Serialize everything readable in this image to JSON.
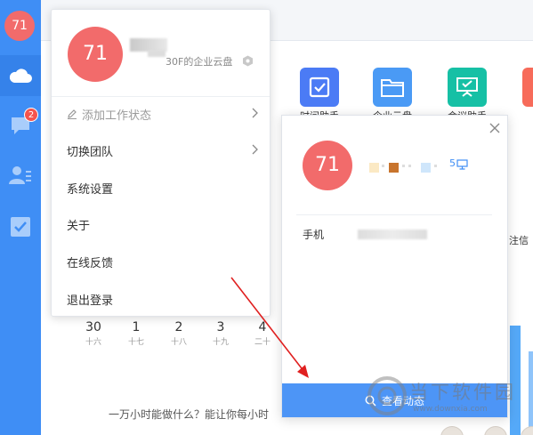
{
  "rail": {
    "avatar_text": "71",
    "badge_count": "2",
    "nav_items": [
      {
        "name": "cloud-icon",
        "active": true
      },
      {
        "name": "chat-icon",
        "active": false
      },
      {
        "name": "contacts-icon",
        "active": false
      },
      {
        "name": "checkbox-icon",
        "active": false
      }
    ]
  },
  "apps": [
    {
      "label": "时间助手",
      "icon": "checkbox-icon",
      "color": "#4b7bf5"
    },
    {
      "label": "企业云盘",
      "icon": "folder-icon",
      "color": "#4a9af5"
    },
    {
      "label": "会议助手",
      "icon": "presentation-icon",
      "color": "#16c0a5"
    },
    {
      "label": "",
      "icon": "app-icon",
      "color": "#f76b5a"
    }
  ],
  "side_text": "注信",
  "calendar": [
    {
      "day": "30",
      "sub": "十六"
    },
    {
      "day": "1",
      "sub": "十七"
    },
    {
      "day": "2",
      "sub": "十八"
    },
    {
      "day": "3",
      "sub": "十九"
    },
    {
      "day": "4",
      "sub": "二十"
    }
  ],
  "bottom_text": "一万小时能做什么？能让你每小时",
  "menu": {
    "avatar_text": "71",
    "team_suffix": "30F的企业云盘",
    "items": [
      {
        "label": "添加工作状态",
        "muted": true,
        "chevron": true,
        "icon": "edit-icon"
      },
      {
        "label": "切换团队",
        "muted": false,
        "chevron": true,
        "icon": ""
      },
      {
        "label": "系统设置",
        "muted": false,
        "chevron": false,
        "icon": ""
      },
      {
        "label": "关于",
        "muted": false,
        "chevron": false,
        "icon": ""
      },
      {
        "label": "在线反馈",
        "muted": false,
        "chevron": false,
        "icon": ""
      },
      {
        "label": "退出登录",
        "muted": false,
        "chevron": false,
        "icon": ""
      }
    ]
  },
  "card": {
    "avatar_text": "71",
    "digit": "5",
    "phone_label": "手机",
    "action_label": "查看动态"
  },
  "watermark": {
    "text": "当下软件园",
    "url": "www.downxia.com"
  },
  "colors": {
    "rail": "#3f8ef5",
    "avatar": "#f26b6b",
    "accent": "#4d95f6",
    "arrow": "#e02020"
  }
}
